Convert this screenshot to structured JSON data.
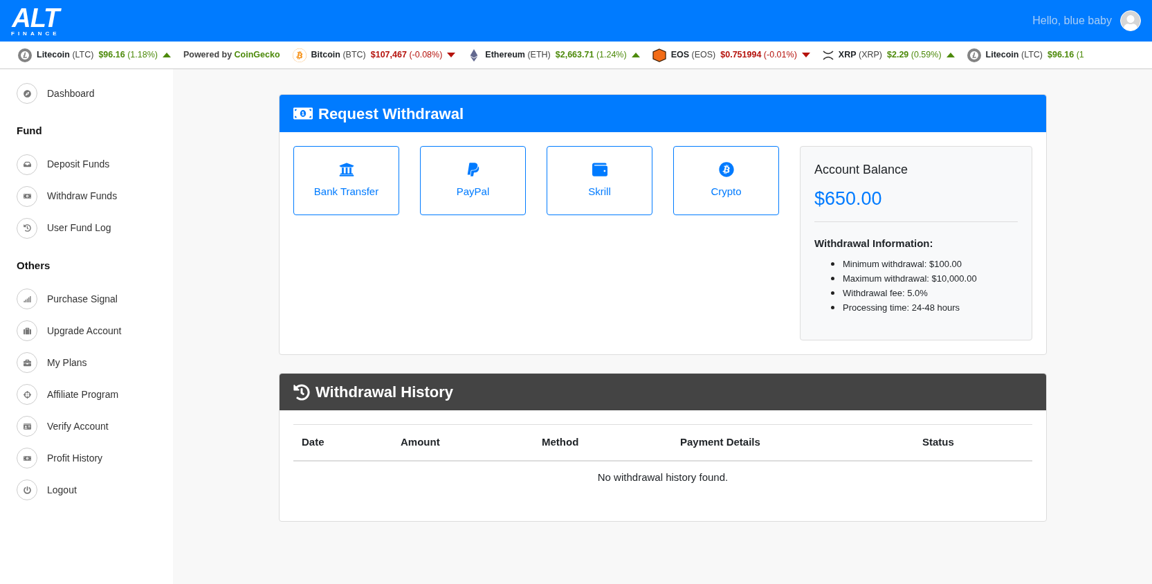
{
  "header": {
    "greeting": "Hello, blue baby"
  },
  "logo": {
    "text": "ALT",
    "subtext": "FINANCE"
  },
  "ticker": [
    {
      "kind": "litecoin",
      "name": "Litecoin",
      "symbol": "(LTC)",
      "price": "$96.16",
      "change": "(1.18%)",
      "rising": true
    },
    {
      "kind": "credit",
      "prefix": "Powered by",
      "brand": "CoinGecko"
    },
    {
      "kind": "bitcoin",
      "name": "Bitcoin",
      "symbol": "(BTC)",
      "price": "$107,467",
      "change": "(-0.08%)",
      "rising": false
    },
    {
      "kind": "ethereum",
      "name": "Ethereum",
      "symbol": "(ETH)",
      "price": "$2,663.71",
      "change": "(1.24%)",
      "rising": true
    },
    {
      "kind": "eos",
      "name": "EOS",
      "symbol": "(EOS)",
      "price": "$0.751994",
      "change": "(-0.01%)",
      "rising": false
    },
    {
      "kind": "xrp",
      "name": "XRP",
      "symbol": "(XRP)",
      "price": "$2.29",
      "change": "(0.59%)",
      "rising": true
    },
    {
      "kind": "litecoin",
      "name": "Litecoin",
      "symbol": "(LTC)",
      "price": "$96.16",
      "change": "(1"
    }
  ],
  "sidebar": {
    "sections": [
      {
        "items": [
          {
            "label": "Dashboard",
            "kind": "compass"
          }
        ]
      },
      {
        "heading": "Fund",
        "items": [
          {
            "label": "Deposit Funds",
            "kind": "inbox"
          },
          {
            "label": "Withdraw Funds",
            "kind": "money"
          },
          {
            "label": "User Fund Log",
            "kind": "history"
          }
        ]
      },
      {
        "heading": "Others",
        "items": [
          {
            "label": "Purchase Signal",
            "kind": "signal"
          },
          {
            "label": "Upgrade Account",
            "kind": "suitcase"
          },
          {
            "label": "My Plans",
            "kind": "briefcase"
          },
          {
            "label": "Affiliate Program",
            "kind": "crosshairs"
          },
          {
            "label": "Verify Account",
            "kind": "idcard"
          },
          {
            "label": "Profit History",
            "kind": "money"
          },
          {
            "label": "Logout",
            "kind": "power"
          }
        ]
      }
    ]
  },
  "request_card": {
    "title": "Request Withdrawal",
    "methods": [
      {
        "label": "Bank Transfer",
        "kind": "bank"
      },
      {
        "label": "PayPal",
        "kind": "paypal"
      },
      {
        "label": "Skrill",
        "kind": "wallet"
      },
      {
        "label": "Crypto",
        "kind": "bitcoin"
      }
    ],
    "balance": {
      "title": "Account Balance",
      "amount": "$650.00",
      "info_title": "Withdrawal Information:",
      "info": [
        "Minimum withdrawal: $100.00",
        "Maximum withdrawal: $10,000.00",
        "Withdrawal fee: 5.0%",
        "Processing time: 24-48 hours"
      ]
    }
  },
  "history_card": {
    "title": "Withdrawal History",
    "table": {
      "columns": [
        "Date",
        "Amount",
        "Method",
        "Payment Details",
        "Status"
      ],
      "empty_message": "No withdrawal history found."
    }
  }
}
